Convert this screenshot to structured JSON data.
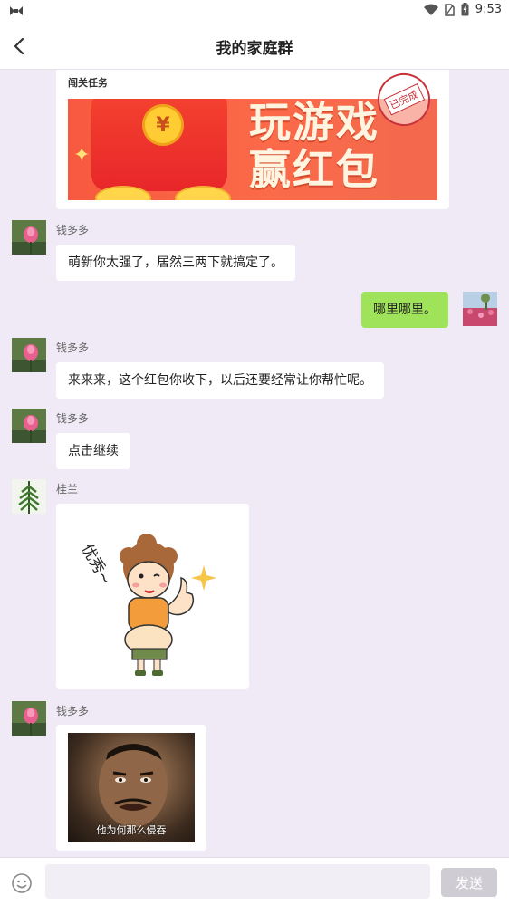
{
  "status": {
    "time": "9:53"
  },
  "header": {
    "title": "我的家庭群",
    "back_icon": "chevron-left-icon"
  },
  "card": {
    "title": "闯关任务",
    "banner_line1": "玩游戏",
    "banner_line2": "赢红包",
    "stamp": "已完成",
    "coin_symbol": "¥"
  },
  "messages": [
    {
      "sender": "钱多多",
      "text": "萌新你太强了，居然三两下就搞定了。"
    },
    {
      "sender": "",
      "text": "哪里哪里。"
    },
    {
      "sender": "钱多多",
      "text": "来来来，这个红包你收下，以后还要经常让你帮忙呢。"
    },
    {
      "sender": "钱多多",
      "text": "点击继续"
    },
    {
      "sender": "桂兰",
      "sticker_text": "优秀~"
    },
    {
      "sender": "钱多多",
      "photo_caption": "他为何那么侵吞"
    }
  ],
  "input": {
    "placeholder": "",
    "send_label": "发送"
  },
  "colors": {
    "mine_bubble": "#9fe35a",
    "background": "#efeaf5",
    "send_disabled": "#cfcdd3"
  }
}
